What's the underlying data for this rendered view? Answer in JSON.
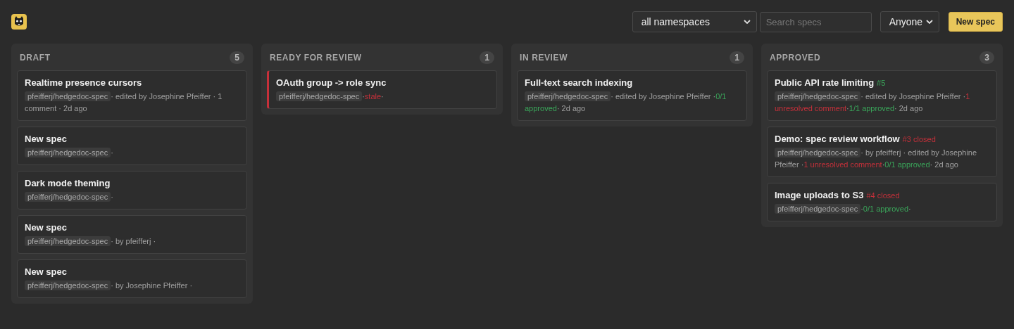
{
  "toolbar": {
    "namespace_filter": "all namespaces",
    "search": {
      "placeholder": "Search specs"
    },
    "author_filter": "Anyone",
    "new_button": "New spec"
  },
  "columns": [
    {
      "title": "DRAFT",
      "count": "5",
      "cards": [
        {
          "title": "Realtime presence cursors",
          "stale": false,
          "repo": "pfeifferj/hedgedoc-spec",
          "meta": [
            {
              "text": "· edited by Josephine Pfeiffer · 1 comment · 2d ago"
            }
          ]
        },
        {
          "title": "New spec",
          "stale": false,
          "repo": "pfeifferj/hedgedoc-spec",
          "meta": [
            {
              "text": "·"
            }
          ]
        },
        {
          "title": "Dark mode theming",
          "stale": false,
          "repo": "pfeifferj/hedgedoc-spec",
          "meta": [
            {
              "text": "·"
            }
          ]
        },
        {
          "title": "New spec",
          "stale": false,
          "repo": "pfeifferj/hedgedoc-spec",
          "meta": [
            {
              "text": "· by pfeifferj ·"
            }
          ]
        },
        {
          "title": "New spec",
          "stale": false,
          "repo": "pfeifferj/hedgedoc-spec",
          "meta": [
            {
              "text": "· by Josephine Pfeiffer ·"
            }
          ]
        }
      ]
    },
    {
      "title": "READY FOR REVIEW",
      "count": "1",
      "cards": [
        {
          "title": "OAuth group -> role sync",
          "stale": true,
          "repo": "pfeifferj/hedgedoc-spec",
          "meta": [
            {
              "text": "·"
            },
            {
              "text": "stale",
              "color": "#c6303a"
            },
            {
              "text": "·"
            }
          ]
        }
      ]
    },
    {
      "title": "IN REVIEW",
      "count": "1",
      "cards": [
        {
          "title": "Full-text search indexing",
          "stale": false,
          "repo": "pfeifferj/hedgedoc-spec",
          "meta": [
            {
              "text": "· edited by Josephine Pfeiffer ·"
            },
            {
              "text": "0/1 approved",
              "color": "#3aa65a"
            },
            {
              "text": "· 2d ago"
            }
          ]
        }
      ]
    },
    {
      "title": "APPROVED",
      "count": "3",
      "cards": [
        {
          "title": "Public API rate limiting",
          "badge": {
            "text": "#5",
            "kind": "open"
          },
          "stale": false,
          "repo": "pfeifferj/hedgedoc-spec",
          "meta": [
            {
              "text": "· edited by Josephine Pfeiffer ·"
            },
            {
              "text": "1 unresolved comment",
              "color": "#c6303a"
            },
            {
              "text": "·"
            },
            {
              "text": "1/1 approved",
              "color": "#3aa65a"
            },
            {
              "text": "· 2d ago"
            }
          ]
        },
        {
          "title": "Demo: spec review workflow",
          "badge": {
            "text": "#3 closed",
            "kind": "closed"
          },
          "stale": false,
          "repo": "pfeifferj/hedgedoc-spec",
          "meta": [
            {
              "text": "· by pfeifferj · edited by Josephine Pfeiffer ·"
            },
            {
              "text": "1 unresolved comment",
              "color": "#c6303a"
            },
            {
              "text": "·"
            },
            {
              "text": "0/1 approved",
              "color": "#3aa65a"
            },
            {
              "text": "· 2d ago"
            }
          ]
        },
        {
          "title": "Image uploads to S3",
          "badge": {
            "text": "#4 closed",
            "kind": "closed"
          },
          "stale": false,
          "repo": "pfeifferj/hedgedoc-spec",
          "meta": [
            {
              "text": "·"
            },
            {
              "text": "0/1 approved",
              "color": "#3aa65a"
            },
            {
              "text": "·"
            }
          ]
        }
      ]
    }
  ]
}
